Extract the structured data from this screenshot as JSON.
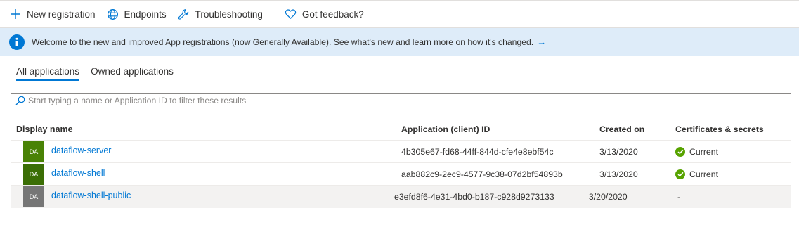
{
  "toolbar": {
    "new_registration": "New registration",
    "endpoints": "Endpoints",
    "troubleshooting": "Troubleshooting",
    "feedback": "Got feedback?"
  },
  "banner": {
    "text": "Welcome to the new and improved App registrations (now Generally Available). See what's new and learn more on how it's changed.",
    "arrow": "→"
  },
  "tabs": {
    "all": "All applications",
    "owned": "Owned applications"
  },
  "search": {
    "placeholder": "Start typing a name or Application ID to filter these results",
    "value": ""
  },
  "table": {
    "headers": {
      "name": "Display name",
      "id": "Application (client) ID",
      "created": "Created on",
      "certs": "Certificates & secrets"
    },
    "rows": [
      {
        "initials": "DA",
        "avatar_color": "#498205",
        "name": "dataflow-server",
        "app_id": "4b305e67-fd68-44ff-844d-cfe4e8ebf54c",
        "created": "3/13/2020",
        "cert": "Current"
      },
      {
        "initials": "DA",
        "avatar_color": "#3b6e05",
        "name": "dataflow-shell",
        "app_id": "aab882c9-2ec9-4577-9c38-07d2bf54893b",
        "created": "3/13/2020",
        "cert": "Current"
      },
      {
        "initials": "DA",
        "avatar_color": "#767676",
        "name": "dataflow-shell-public",
        "app_id": "e3efd8f6-4e31-4bd0-b187-c928d9273133",
        "created": "3/20/2020",
        "cert": "-"
      }
    ]
  },
  "colors": {
    "accent": "#0078d4",
    "banner_bg": "#deecf9",
    "status_ok": "#57a300"
  },
  "icons": {
    "new_registration": "plus-icon",
    "endpoints": "globe-icon",
    "troubleshooting": "wrench-icon",
    "feedback": "heart-icon",
    "banner": "info-icon",
    "search": "search-icon",
    "cert_status": "check-circle-icon"
  }
}
